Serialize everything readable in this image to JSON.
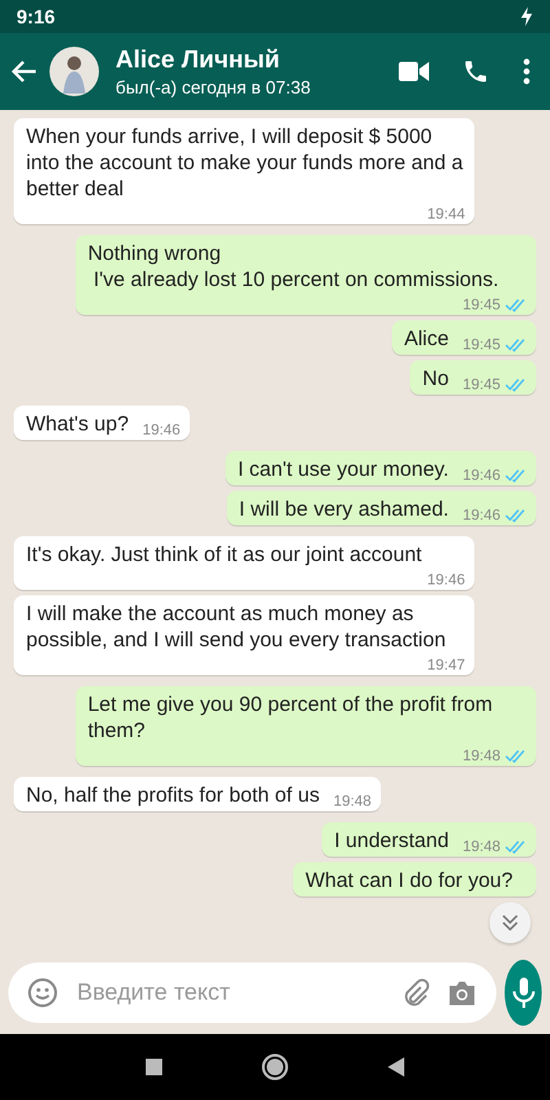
{
  "status_bar": {
    "time": "9:16"
  },
  "header": {
    "name": "Alice Личный",
    "last_seen": "был(-а) сегодня в 07:38"
  },
  "messages": [
    {
      "kind": "in",
      "text": "When your funds arrive, I will deposit $ 5000 into the account to make your funds more and a better deal",
      "time": "19:44"
    },
    {
      "kind": "out",
      "text": "Nothing wrong\n I've already lost 10 percent on commissions.",
      "time": "19:45",
      "read": true
    },
    {
      "kind": "out",
      "text": "Alice",
      "time": "19:45",
      "read": true
    },
    {
      "kind": "out",
      "text": "No",
      "time": "19:45",
      "read": true
    },
    {
      "kind": "in",
      "text": "What's up?",
      "time": "19:46"
    },
    {
      "kind": "out",
      "text": "I can't use your money.",
      "time": "19:46",
      "read": true
    },
    {
      "kind": "out",
      "text": "I will be very ashamed.",
      "time": "19:46",
      "read": true
    },
    {
      "kind": "in",
      "text": "It's okay. Just think of it as our joint account",
      "time": "19:46"
    },
    {
      "kind": "in",
      "text": "I will make the account as much money as possible, and I will send you every transaction",
      "time": "19:47"
    },
    {
      "kind": "out",
      "text": "Let me give you 90 percent of the profit from them?",
      "time": "19:48",
      "read": true
    },
    {
      "kind": "in",
      "text": "No, half the profits for both of us",
      "time": "19:48"
    },
    {
      "kind": "out",
      "text": "I understand",
      "time": "19:48",
      "read": true
    },
    {
      "kind": "out",
      "text": "What can I do for you?"
    }
  ],
  "composer": {
    "placeholder": "Введите текст"
  }
}
